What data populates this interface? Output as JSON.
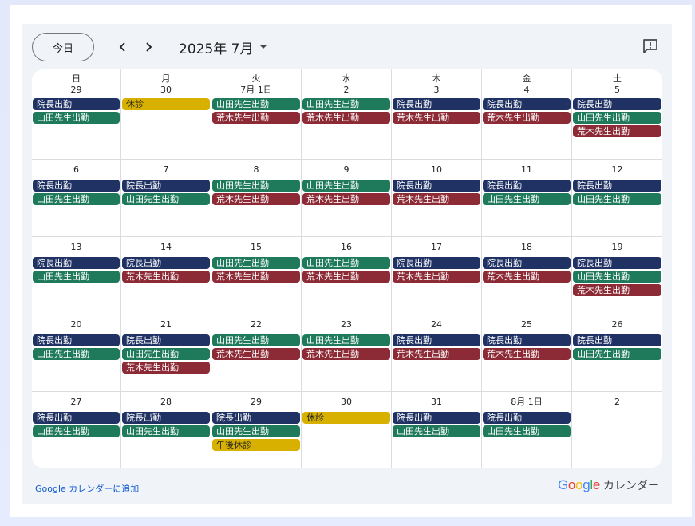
{
  "toolbar": {
    "today_label": "今日",
    "month_title": "2025年 7月"
  },
  "colors": {
    "navy": "#1f3263",
    "green": "#1f7a5c",
    "red": "#8c2a35",
    "yellow": "#d8b100"
  },
  "calendar": {
    "weekdays": [
      "日",
      "月",
      "火",
      "水",
      "木",
      "金",
      "土"
    ],
    "weeks": [
      [
        {
          "date": "29",
          "events": [
            {
              "label": "院長出勤",
              "color": "navy"
            },
            {
              "label": "山田先生出勤",
              "color": "green"
            }
          ]
        },
        {
          "date": "30",
          "events": [
            {
              "label": "休診",
              "color": "yellow"
            }
          ]
        },
        {
          "date": "7月 1日",
          "events": [
            {
              "label": "山田先生出勤",
              "color": "green"
            },
            {
              "label": "荒木先生出勤",
              "color": "red"
            }
          ]
        },
        {
          "date": "2",
          "events": [
            {
              "label": "山田先生出勤",
              "color": "green"
            },
            {
              "label": "荒木先生出勤",
              "color": "red"
            }
          ]
        },
        {
          "date": "3",
          "events": [
            {
              "label": "院長出勤",
              "color": "navy"
            },
            {
              "label": "荒木先生出勤",
              "color": "red"
            }
          ]
        },
        {
          "date": "4",
          "events": [
            {
              "label": "院長出勤",
              "color": "navy"
            },
            {
              "label": "荒木先生出勤",
              "color": "red"
            }
          ]
        },
        {
          "date": "5",
          "events": [
            {
              "label": "院長出勤",
              "color": "navy"
            },
            {
              "label": "山田先生出勤",
              "color": "green"
            },
            {
              "label": "荒木先生出勤",
              "color": "red"
            }
          ]
        }
      ],
      [
        {
          "date": "6",
          "events": [
            {
              "label": "院長出勤",
              "color": "navy"
            },
            {
              "label": "山田先生出勤",
              "color": "green"
            }
          ]
        },
        {
          "date": "7",
          "events": [
            {
              "label": "院長出勤",
              "color": "navy"
            },
            {
              "label": "山田先生出勤",
              "color": "green"
            }
          ]
        },
        {
          "date": "8",
          "events": [
            {
              "label": "山田先生出勤",
              "color": "green"
            },
            {
              "label": "荒木先生出勤",
              "color": "red"
            }
          ]
        },
        {
          "date": "9",
          "events": [
            {
              "label": "山田先生出勤",
              "color": "green"
            },
            {
              "label": "荒木先生出勤",
              "color": "red"
            }
          ]
        },
        {
          "date": "10",
          "events": [
            {
              "label": "院長出勤",
              "color": "navy"
            },
            {
              "label": "荒木先生出勤",
              "color": "red"
            }
          ]
        },
        {
          "date": "11",
          "events": [
            {
              "label": "院長出勤",
              "color": "navy"
            },
            {
              "label": "山田先生出勤",
              "color": "green"
            }
          ]
        },
        {
          "date": "12",
          "events": [
            {
              "label": "院長出勤",
              "color": "navy"
            },
            {
              "label": "山田先生出勤",
              "color": "green"
            }
          ]
        }
      ],
      [
        {
          "date": "13",
          "events": [
            {
              "label": "院長出勤",
              "color": "navy"
            },
            {
              "label": "山田先生出勤",
              "color": "green"
            }
          ]
        },
        {
          "date": "14",
          "events": [
            {
              "label": "院長出勤",
              "color": "navy"
            },
            {
              "label": "荒木先生出勤",
              "color": "red"
            }
          ]
        },
        {
          "date": "15",
          "events": [
            {
              "label": "山田先生出勤",
              "color": "green"
            },
            {
              "label": "荒木先生出勤",
              "color": "red"
            }
          ]
        },
        {
          "date": "16",
          "events": [
            {
              "label": "山田先生出勤",
              "color": "green"
            },
            {
              "label": "荒木先生出勤",
              "color": "red"
            }
          ]
        },
        {
          "date": "17",
          "events": [
            {
              "label": "院長出勤",
              "color": "navy"
            },
            {
              "label": "荒木先生出勤",
              "color": "red"
            }
          ]
        },
        {
          "date": "18",
          "events": [
            {
              "label": "院長出勤",
              "color": "navy"
            },
            {
              "label": "荒木先生出勤",
              "color": "red"
            }
          ]
        },
        {
          "date": "19",
          "events": [
            {
              "label": "院長出勤",
              "color": "navy"
            },
            {
              "label": "山田先生出勤",
              "color": "green"
            },
            {
              "label": "荒木先生出勤",
              "color": "red"
            }
          ]
        }
      ],
      [
        {
          "date": "20",
          "events": [
            {
              "label": "院長出勤",
              "color": "navy"
            },
            {
              "label": "山田先生出勤",
              "color": "green"
            }
          ]
        },
        {
          "date": "21",
          "events": [
            {
              "label": "院長出勤",
              "color": "navy"
            },
            {
              "label": "山田先生出勤",
              "color": "green"
            },
            {
              "label": "荒木先生出勤",
              "color": "red"
            }
          ]
        },
        {
          "date": "22",
          "events": [
            {
              "label": "山田先生出勤",
              "color": "green"
            },
            {
              "label": "荒木先生出勤",
              "color": "red"
            }
          ]
        },
        {
          "date": "23",
          "events": [
            {
              "label": "山田先生出勤",
              "color": "green"
            },
            {
              "label": "荒木先生出勤",
              "color": "red"
            }
          ]
        },
        {
          "date": "24",
          "events": [
            {
              "label": "院長出勤",
              "color": "navy"
            },
            {
              "label": "荒木先生出勤",
              "color": "red"
            }
          ]
        },
        {
          "date": "25",
          "events": [
            {
              "label": "院長出勤",
              "color": "navy"
            },
            {
              "label": "荒木先生出勤",
              "color": "red"
            }
          ]
        },
        {
          "date": "26",
          "events": [
            {
              "label": "院長出勤",
              "color": "navy"
            },
            {
              "label": "山田先生出勤",
              "color": "green"
            }
          ]
        }
      ],
      [
        {
          "date": "27",
          "events": [
            {
              "label": "院長出勤",
              "color": "navy"
            },
            {
              "label": "山田先生出勤",
              "color": "green"
            }
          ]
        },
        {
          "date": "28",
          "events": [
            {
              "label": "院長出勤",
              "color": "navy"
            },
            {
              "label": "山田先生出勤",
              "color": "green"
            }
          ]
        },
        {
          "date": "29",
          "events": [
            {
              "label": "院長出勤",
              "color": "navy"
            },
            {
              "label": "山田先生出勤",
              "color": "green"
            },
            {
              "label": "午後休診",
              "color": "yellow"
            }
          ]
        },
        {
          "date": "30",
          "events": [
            {
              "label": "休診",
              "color": "yellow"
            }
          ]
        },
        {
          "date": "31",
          "events": [
            {
              "label": "院長出勤",
              "color": "navy"
            },
            {
              "label": "山田先生出勤",
              "color": "green"
            }
          ]
        },
        {
          "date": "8月 1日",
          "events": [
            {
              "label": "院長出勤",
              "color": "navy"
            },
            {
              "label": "山田先生出勤",
              "color": "green"
            }
          ]
        },
        {
          "date": "2",
          "events": []
        }
      ]
    ]
  },
  "footer": {
    "add_link": "Google カレンダーに追加",
    "brand_logo": "Google",
    "brand_label": "カレンダー"
  },
  "icons": {
    "prev": "chevron-left-icon",
    "next": "chevron-right-icon",
    "dropdown": "caret-down-icon",
    "feedback": "feedback-icon"
  }
}
